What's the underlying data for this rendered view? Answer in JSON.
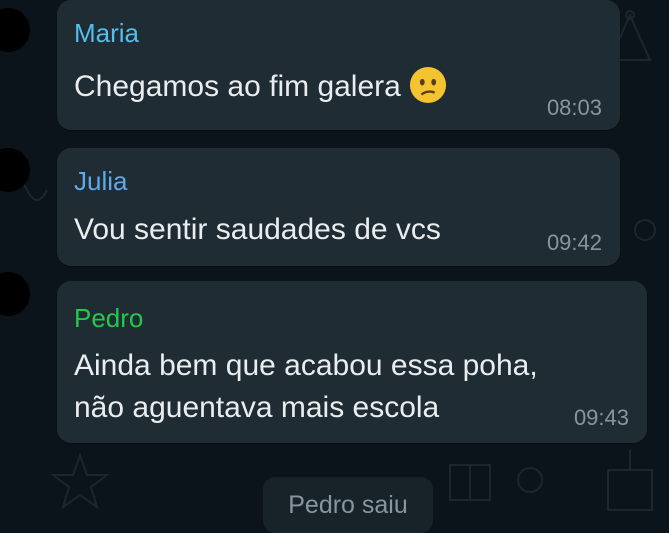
{
  "messages": [
    {
      "sender": "Maria",
      "sender_color": "#53bdeb",
      "text_lines": [
        "Chegamos ao fim galera"
      ],
      "emoji": "confused-face-icon",
      "time": "08:03"
    },
    {
      "sender": "Julia",
      "sender_color": "#5fa9e8",
      "text_lines": [
        "Vou sentir saudades de vcs"
      ],
      "time": "09:42"
    },
    {
      "sender": "Pedro",
      "sender_color": "#25c74b",
      "text_lines": [
        "Ainda bem que acabou essa poha,",
        "não aguentava mais escola"
      ],
      "time": "09:43"
    }
  ],
  "system_message": "Pedro saiu",
  "colors": {
    "background": "#0b141a",
    "bubble": "#202c33",
    "text": "#e9edef",
    "time": "#8696a0"
  }
}
